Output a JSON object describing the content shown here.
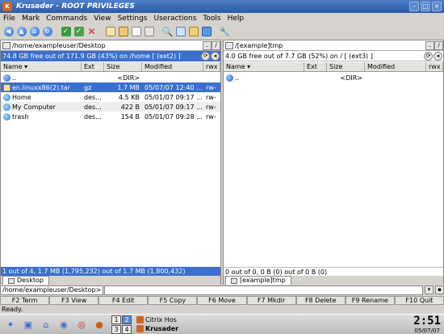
{
  "window": {
    "title": "Krusader - ROOT PRIVILEGES"
  },
  "menubar": {
    "items": [
      "File",
      "Mark",
      "Commands",
      "View",
      "Settings",
      "Useractions",
      "Tools",
      "Help"
    ]
  },
  "toolbar": {
    "icons": [
      "back-icon",
      "up-icon",
      "home-icon",
      "reload-icon",
      "select-icon",
      "unselect-icon",
      "delete-icon",
      "copy-icon",
      "move-icon",
      "mkdir-icon",
      "view-icon",
      "search-icon",
      "compare-icon",
      "sync-icon",
      "terminal-icon",
      "config-icon"
    ]
  },
  "left_panel": {
    "path": "/home/exampleuser/Desktop",
    "free": "74.8 GB free out of 171.9 GB (43%) on /home [ (ext2) ]",
    "columns": [
      "Name",
      "Ext",
      "Size",
      "Modified",
      "rwx"
    ],
    "rows": [
      {
        "icon": "up",
        "name": "..",
        "ext": "",
        "size": "<DIR>",
        "modified": "",
        "rwx": ""
      },
      {
        "icon": "file",
        "name": "en.linuxx86(2).tar",
        "ext": "gz",
        "size": "1.7 MB",
        "modified": "05/07/07 12:40 ...",
        "rwx": "rw-",
        "selected": true
      },
      {
        "icon": "dir",
        "name": "Home",
        "ext": "des...",
        "size": "4.5 KB",
        "modified": "05/01/07 09:17 ...",
        "rwx": "rw-"
      },
      {
        "icon": "dir",
        "name": "My Computer",
        "ext": "des...",
        "size": "422 B",
        "modified": "05/01/07 09:17 ...",
        "rwx": "rw-"
      },
      {
        "icon": "dir",
        "name": "trash",
        "ext": "des...",
        "size": "154 B",
        "modified": "05/01/07 09:28 ...",
        "rwx": "rw-"
      }
    ],
    "status": "1 out of 4, 1.7 MB (1,795,232) out of 1.7 MB (1,800,432)",
    "tab": "Desktop"
  },
  "right_panel": {
    "path": "/[example]tmp",
    "free": "4.0 GB free out of 7.7 GB (52%) on / [ (ext3) ]",
    "columns": [
      "Name",
      "Ext",
      "Size",
      "Modified",
      "rwx"
    ],
    "rows": [
      {
        "icon": "up",
        "name": "..",
        "ext": "",
        "size": "<DIR>",
        "modified": "",
        "rwx": ""
      }
    ],
    "status": "0 out of 0, 0 B (0) out of 0 B (0)",
    "tab": "[example]tmp"
  },
  "cmdline": {
    "prompt": "/home/exampleuser/Desktop>"
  },
  "fkeys": [
    "F2 Term",
    "F3 View",
    "F4 Edit",
    "F5 Copy",
    "F6 Move",
    "F7 Mkdir",
    "F8 Delete",
    "F9 Rename",
    "F10 Quit"
  ],
  "statusbar": "Ready.",
  "taskbar": {
    "pager": [
      "1",
      "2",
      "3",
      "4"
    ],
    "tasks": [
      "Citrix Hos",
      "Krusader"
    ],
    "time": "2:51",
    "date": "05/07/07"
  }
}
